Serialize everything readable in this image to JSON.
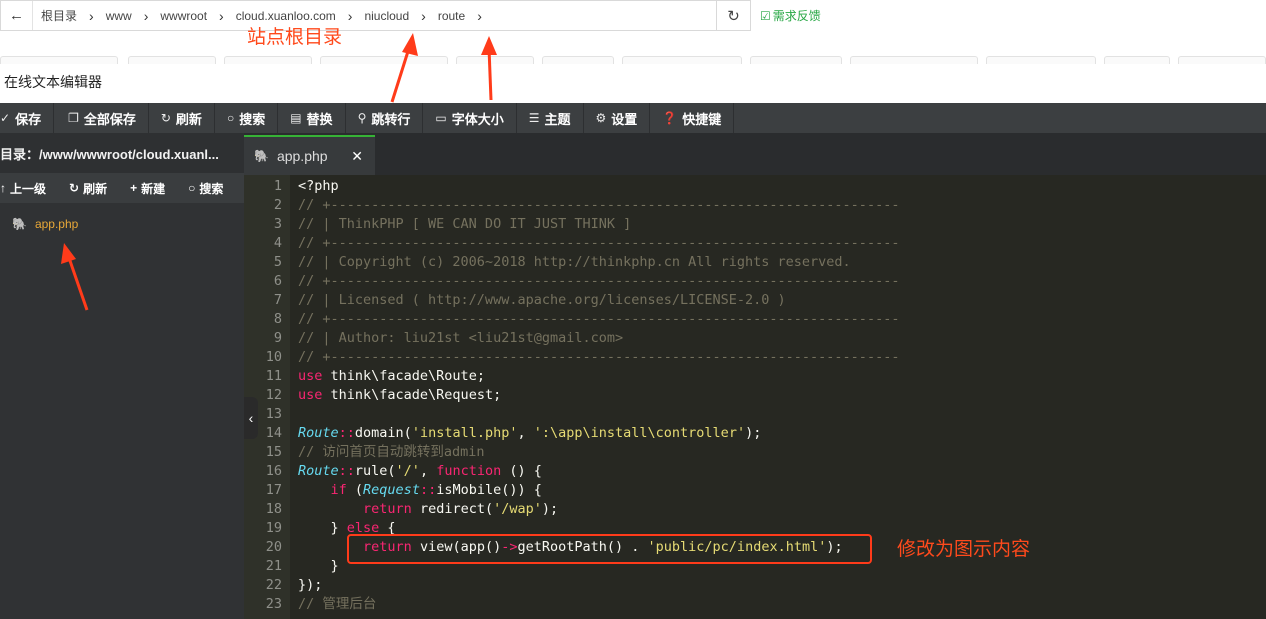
{
  "breadcrumb": {
    "items": [
      "根目录",
      "www",
      "wwwroot",
      "cloud.xuanloo.com",
      "niucloud",
      "route"
    ]
  },
  "feedback": {
    "label": "需求反馈",
    "color": "#27a744"
  },
  "page_title": "在线文本编辑器",
  "toolbar": {
    "buttons": [
      {
        "icon": "check-icon",
        "label": "保存"
      },
      {
        "icon": "copy-icon",
        "label": "全部保存"
      },
      {
        "icon": "refresh-icon",
        "label": "刷新"
      },
      {
        "icon": "search-icon",
        "label": "搜索"
      },
      {
        "icon": "replace-icon",
        "label": "替换"
      },
      {
        "icon": "goto-line-icon",
        "label": "跳转行"
      },
      {
        "icon": "font-size-icon",
        "label": "字体大小"
      },
      {
        "icon": "menu-icon",
        "label": "主题"
      },
      {
        "icon": "gear-icon",
        "label": "设置"
      },
      {
        "icon": "help-icon",
        "label": "快捷键"
      }
    ]
  },
  "sidebar": {
    "directory": "目录：/www/wwwroot/cloud.xuanl...",
    "tools": [
      {
        "icon": "up-icon",
        "label": "上一级"
      },
      {
        "icon": "refresh-icon",
        "label": "刷新"
      },
      {
        "icon": "plus-icon",
        "label": "新建"
      },
      {
        "icon": "search-icon",
        "label": "搜索"
      }
    ],
    "files": [
      {
        "icon": "php-elephant-icon",
        "name": "app.php"
      }
    ]
  },
  "editor": {
    "active_tab": "app.php",
    "lines": [
      {
        "n": "1",
        "tokens": [
          [
            "pl",
            "<?php"
          ]
        ]
      },
      {
        "n": "2",
        "tokens": [
          [
            "cm",
            "// +----------------------------------------------------------------------"
          ]
        ]
      },
      {
        "n": "3",
        "tokens": [
          [
            "cm",
            "// | ThinkPHP [ WE CAN DO IT JUST THINK ]"
          ]
        ]
      },
      {
        "n": "4",
        "tokens": [
          [
            "cm",
            "// +----------------------------------------------------------------------"
          ]
        ]
      },
      {
        "n": "5",
        "tokens": [
          [
            "cm",
            "// | Copyright (c) 2006~2018 http://thinkphp.cn All rights reserved."
          ]
        ]
      },
      {
        "n": "6",
        "tokens": [
          [
            "cm",
            "// +----------------------------------------------------------------------"
          ]
        ]
      },
      {
        "n": "7",
        "tokens": [
          [
            "cm",
            "// | Licensed ( http://www.apache.org/licenses/LICENSE-2.0 )"
          ]
        ]
      },
      {
        "n": "8",
        "tokens": [
          [
            "cm",
            "// +----------------------------------------------------------------------"
          ]
        ]
      },
      {
        "n": "9",
        "tokens": [
          [
            "cm",
            "// | Author: liu21st <liu21st@gmail.com>"
          ]
        ]
      },
      {
        "n": "10",
        "tokens": [
          [
            "cm",
            "// +----------------------------------------------------------------------"
          ]
        ]
      },
      {
        "n": "11",
        "tokens": [
          [
            "kw",
            "use"
          ],
          [
            "pl",
            " think\\facade\\Route;"
          ]
        ]
      },
      {
        "n": "12",
        "tokens": [
          [
            "kw",
            "use"
          ],
          [
            "pl",
            " think\\facade\\Request;"
          ]
        ]
      },
      {
        "n": "13",
        "tokens": []
      },
      {
        "n": "14",
        "tokens": [
          [
            "cls",
            "Route"
          ],
          [
            "op",
            "::"
          ],
          [
            "pl",
            "domain("
          ],
          [
            "str",
            "'install.php'"
          ],
          [
            "pl",
            ", "
          ],
          [
            "str",
            "':\\app\\install\\controller'"
          ],
          [
            "pl",
            ");"
          ]
        ]
      },
      {
        "n": "15",
        "tokens": [
          [
            "cm",
            "// 访问首页自动跳转到admin"
          ]
        ]
      },
      {
        "n": "16",
        "tokens": [
          [
            "cls",
            "Route"
          ],
          [
            "op",
            "::"
          ],
          [
            "pl",
            "rule("
          ],
          [
            "str",
            "'/'"
          ],
          [
            "pl",
            ", "
          ],
          [
            "kw",
            "function"
          ],
          [
            "pl",
            " () {"
          ]
        ]
      },
      {
        "n": "17",
        "tokens": [
          [
            "pl",
            "    "
          ],
          [
            "kw",
            "if"
          ],
          [
            "pl",
            " ("
          ],
          [
            "cls",
            "Request"
          ],
          [
            "op",
            "::"
          ],
          [
            "pl",
            "isMobile()) {"
          ]
        ]
      },
      {
        "n": "18",
        "tokens": [
          [
            "pl",
            "        "
          ],
          [
            "kw",
            "return"
          ],
          [
            "pl",
            " redirect("
          ],
          [
            "str",
            "'/wap'"
          ],
          [
            "pl",
            ");"
          ]
        ]
      },
      {
        "n": "19",
        "tokens": [
          [
            "pl",
            "    } "
          ],
          [
            "kw",
            "else"
          ],
          [
            "pl",
            " {"
          ]
        ]
      },
      {
        "n": "20",
        "tokens": [
          [
            "pl",
            "        "
          ],
          [
            "kw",
            "return"
          ],
          [
            "pl",
            " view(app()"
          ],
          [
            "op",
            "->"
          ],
          [
            "pl",
            "getRootPath() . "
          ],
          [
            "str",
            "'public/pc/index.html'"
          ],
          [
            "pl",
            ");"
          ]
        ]
      },
      {
        "n": "21",
        "tokens": [
          [
            "pl",
            "    }"
          ]
        ]
      },
      {
        "n": "22",
        "tokens": [
          [
            "pl",
            "});"
          ]
        ]
      },
      {
        "n": "23",
        "tokens": [
          [
            "cm",
            "// 管理后台"
          ]
        ]
      }
    ]
  },
  "annotations": {
    "site_root": "站点根目录",
    "modify": "修改为图示内容",
    "color": "#ff4a1c"
  }
}
